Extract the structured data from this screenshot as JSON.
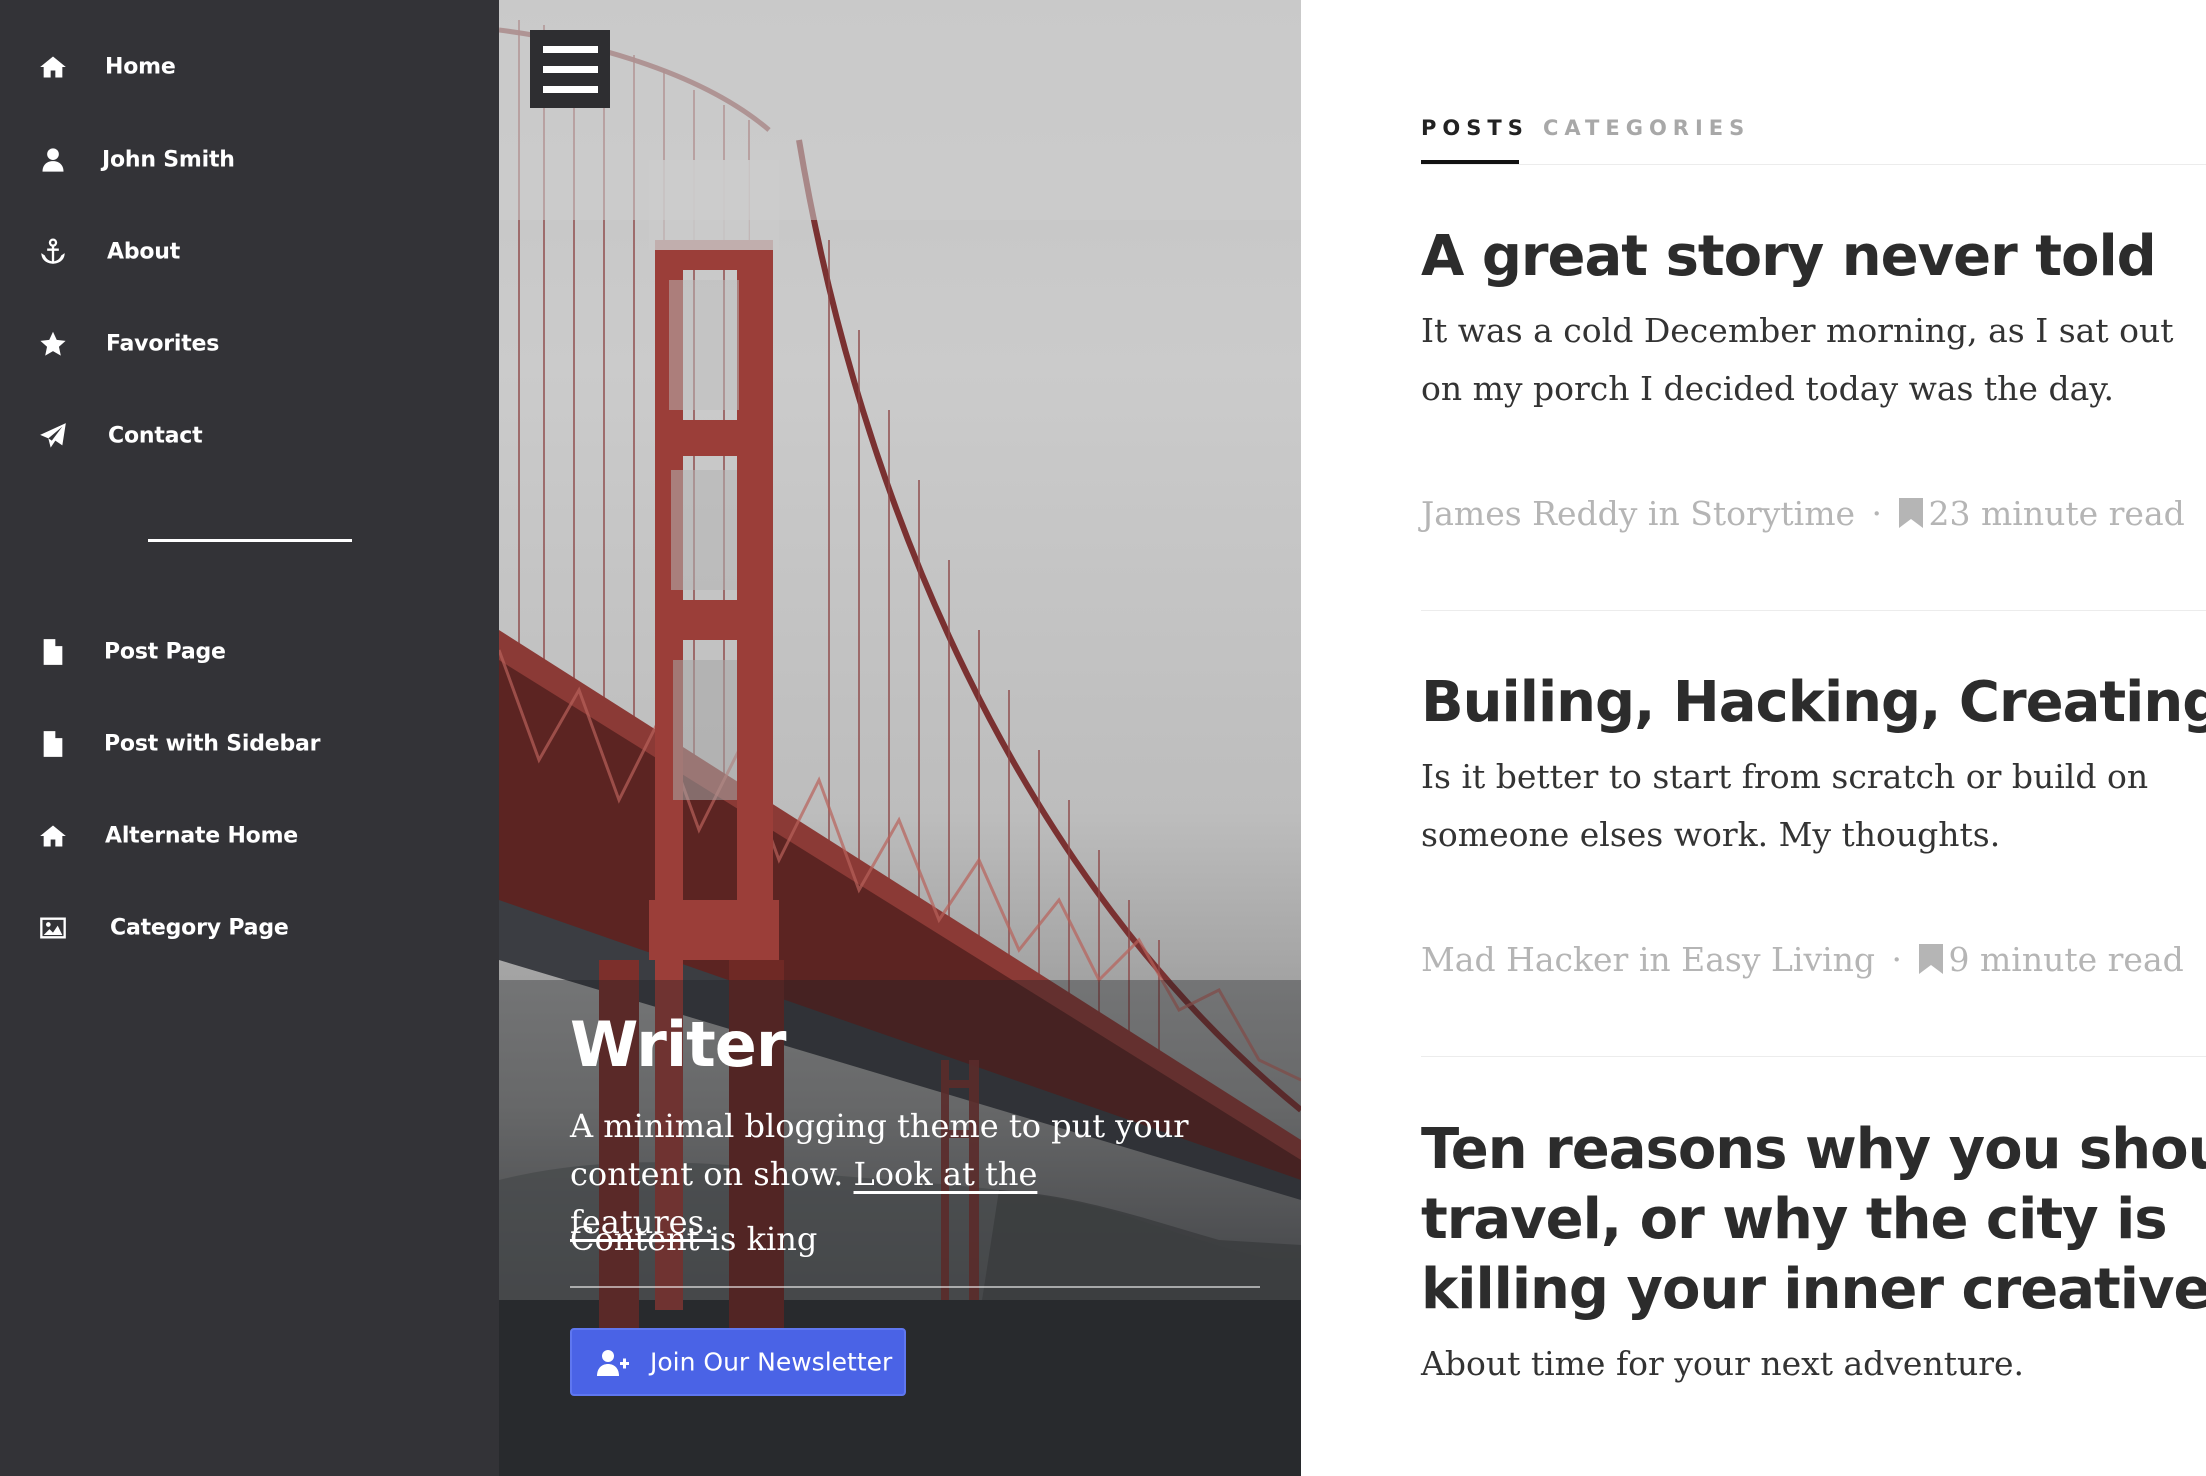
{
  "sidebar": {
    "items": [
      {
        "label": "Home",
        "icon": "home-icon"
      },
      {
        "label": "John Smith",
        "icon": "user-icon"
      },
      {
        "label": "About",
        "icon": "anchor-icon"
      },
      {
        "label": "Favorites",
        "icon": "star-icon"
      },
      {
        "label": "Contact",
        "icon": "paper-plane-icon"
      },
      {
        "label": "Post Page",
        "icon": "file-icon"
      },
      {
        "label": "Post with Sidebar",
        "icon": "file-icon"
      },
      {
        "label": "Alternate Home",
        "icon": "home-icon"
      },
      {
        "label": "Category Page",
        "icon": "image-icon"
      }
    ]
  },
  "hero": {
    "title": "Writer",
    "description": "A minimal blogging theme to put your content on show. ",
    "features_link": "Look at the features.",
    "tagline": "Content is king",
    "newsletter_button": "Join Our Newsletter"
  },
  "tabs": {
    "posts": "POSTS",
    "categories": "CATEGORIES"
  },
  "posts": [
    {
      "title": "A great story never told",
      "excerpt": "It was a cold December morning, as I sat out on my porch I decided today was the day.",
      "author": "James Reddy",
      "in": "in",
      "category": "Storytime",
      "read_time": "23 minute read"
    },
    {
      "title": "Builing, Hacking, Creating",
      "excerpt": "Is it better to start from scratch or build on someone elses work. My thoughts.",
      "author": "Mad Hacker",
      "in": "in",
      "category": "Easy Living",
      "read_time": "9 minute read"
    },
    {
      "title_lines": [
        "Ten reasons why you should",
        "travel, or why the city is",
        "killing your inner creative"
      ],
      "excerpt": "About time for your next adventure."
    }
  ],
  "colors": {
    "sidebar_bg": "#333337",
    "accent_button": "#4a63e6",
    "title_text": "#2c2c2c",
    "meta_text": "#b5b5b5"
  }
}
